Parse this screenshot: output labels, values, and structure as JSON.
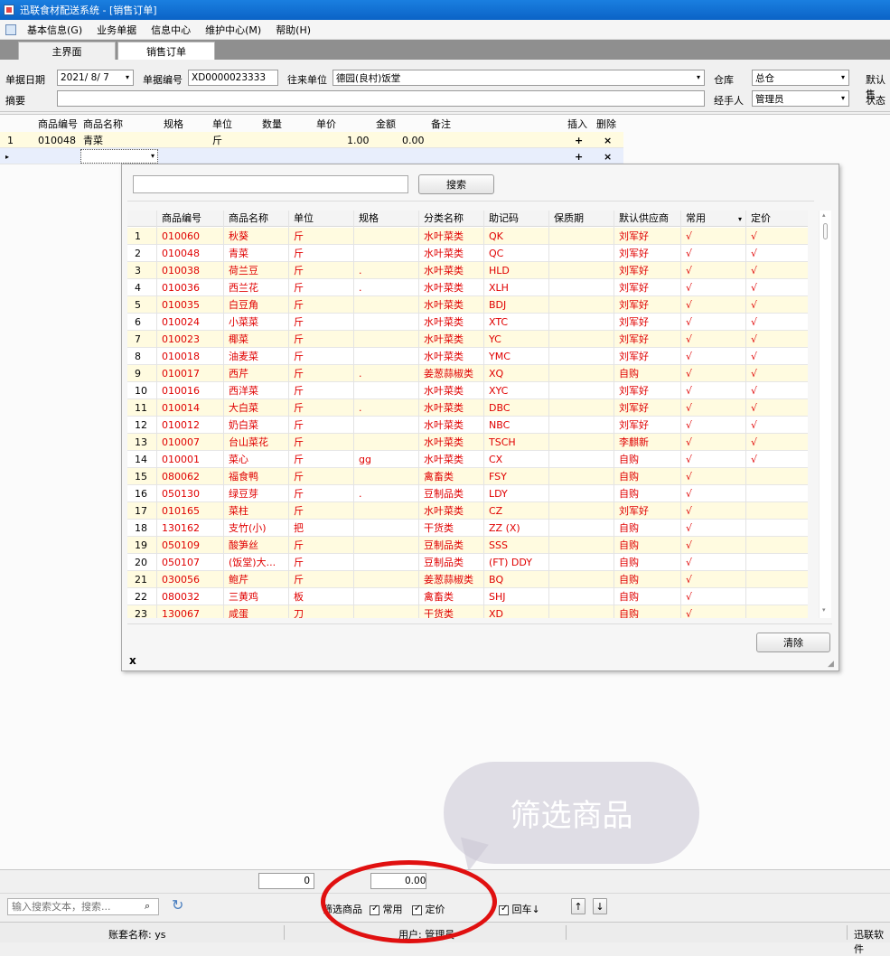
{
  "window": {
    "title": "迅联食材配送系统 - [销售订单]"
  },
  "menu": [
    "基本信息(G)",
    "业务单据",
    "信息中心",
    "维护中心(M)",
    "帮助(H)"
  ],
  "tabs": [
    {
      "label": "主界面"
    },
    {
      "label": "销售订单"
    }
  ],
  "header": {
    "date_label": "单据日期",
    "date_value": "2021/ 8/ 7",
    "doc_no_label": "单据编号",
    "doc_no_value": "XD0000023333",
    "partner_label": "往来单位",
    "partner_value": "德园(良村)饭堂",
    "warehouse_label": "仓库",
    "warehouse_value": "总仓",
    "default_label": "默认售",
    "summary_label": "摘要",
    "handler_label": "经手人",
    "handler_value": "管理员",
    "status_label": "状态"
  },
  "grid": {
    "headers": [
      "商品编号",
      "商品名称",
      "规格",
      "单位",
      "数量",
      "单价",
      "金额",
      "备注",
      "插入",
      "删除"
    ],
    "row1": {
      "no": "1",
      "code": "010048",
      "name": "青菜",
      "unit": "斤",
      "price": "1.00",
      "amount": "0.00",
      "insert": "+",
      "delete": "×"
    },
    "row2": {
      "insert": "+",
      "delete": "×"
    }
  },
  "popup": {
    "search_button": "搜索",
    "clear_button": "清除",
    "close": "x",
    "columns": [
      "商品编号",
      "商品名称",
      "单位",
      "规格",
      "分类名称",
      "助记码",
      "保质期",
      "默认供应商",
      "常用",
      "定价"
    ],
    "rows": [
      [
        "1",
        "010060",
        "秋葵",
        "斤",
        "",
        "水叶菜类",
        "QK",
        "",
        "刘军好",
        "√",
        "√"
      ],
      [
        "2",
        "010048",
        "青菜",
        "斤",
        "",
        "水叶菜类",
        "QC",
        "",
        "刘军好",
        "√",
        "√"
      ],
      [
        "3",
        "010038",
        "荷兰豆",
        "斤",
        ".",
        "水叶菜类",
        "HLD",
        "",
        "刘军好",
        "√",
        "√"
      ],
      [
        "4",
        "010036",
        "西兰花",
        "斤",
        ".",
        "水叶菜类",
        "XLH",
        "",
        "刘军好",
        "√",
        "√"
      ],
      [
        "5",
        "010035",
        "白豆角",
        "斤",
        "",
        "水叶菜类",
        "BDJ",
        "",
        "刘军好",
        "√",
        "√"
      ],
      [
        "6",
        "010024",
        "小菜菜",
        "斤",
        "",
        "水叶菜类",
        "XTC",
        "",
        "刘军好",
        "√",
        "√"
      ],
      [
        "7",
        "010023",
        "椰菜",
        "斤",
        "",
        "水叶菜类",
        "YC",
        "",
        "刘军好",
        "√",
        "√"
      ],
      [
        "8",
        "010018",
        "油麦菜",
        "斤",
        "",
        "水叶菜类",
        "YMC",
        "",
        "刘军好",
        "√",
        "√"
      ],
      [
        "9",
        "010017",
        "西芹",
        "斤",
        ".",
        "姜葱蒜椒类",
        "XQ",
        "",
        "自购",
        "√",
        "√"
      ],
      [
        "10",
        "010016",
        "西洋菜",
        "斤",
        "",
        "水叶菜类",
        "XYC",
        "",
        "刘军好",
        "√",
        "√"
      ],
      [
        "11",
        "010014",
        "大白菜",
        "斤",
        ".",
        "水叶菜类",
        "DBC",
        "",
        "刘军好",
        "√",
        "√"
      ],
      [
        "12",
        "010012",
        "奶白菜",
        "斤",
        "",
        "水叶菜类",
        "NBC",
        "",
        "刘军好",
        "√",
        "√"
      ],
      [
        "13",
        "010007",
        "台山菜花",
        "斤",
        "",
        "水叶菜类",
        "TSCH",
        "",
        "李麒新",
        "√",
        "√"
      ],
      [
        "14",
        "010001",
        "菜心",
        "斤",
        "gg",
        "水叶菜类",
        "CX",
        "",
        "自购",
        "√",
        "√"
      ],
      [
        "15",
        "080062",
        "福食鸭",
        "斤",
        "",
        "禽畜类",
        "FSY",
        "",
        "自购",
        "√",
        ""
      ],
      [
        "16",
        "050130",
        "绿豆芽",
        "斤",
        ".",
        "豆制品类",
        "LDY",
        "",
        "自购",
        "√",
        ""
      ],
      [
        "17",
        "010165",
        "菜柱",
        "斤",
        "",
        "水叶菜类",
        "CZ",
        "",
        "刘军好",
        "√",
        ""
      ],
      [
        "18",
        "130162",
        "支竹(小)",
        "把",
        "",
        "干货类",
        "ZZ (X)",
        "",
        "自购",
        "√",
        ""
      ],
      [
        "19",
        "050109",
        "酸笋丝",
        "斤",
        "",
        "豆制品类",
        "SSS",
        "",
        "自购",
        "√",
        ""
      ],
      [
        "20",
        "050107",
        "(饭堂)大...",
        "斤",
        "",
        "豆制品类",
        "(FT) DDY",
        "",
        "自购",
        "√",
        ""
      ],
      [
        "21",
        "030056",
        "鲍芹",
        "斤",
        "",
        "姜葱蒜椒类",
        "BQ",
        "",
        "自购",
        "√",
        ""
      ],
      [
        "22",
        "080032",
        "三黄鸡",
        "板",
        "",
        "禽畜类",
        "SHJ",
        "",
        "自购",
        "√",
        ""
      ],
      [
        "23",
        "130067",
        "咸蛋",
        "刀",
        "",
        "干货类",
        "XD",
        "",
        "自购",
        "√",
        ""
      ]
    ]
  },
  "totals": {
    "quantity": "0",
    "amount": "0.00"
  },
  "toolbar": {
    "search_placeholder": "输入搜索文本，搜索...",
    "filter_label": "筛选商品",
    "common_label": "常用",
    "pricing_label": "定价",
    "enter_label": "回车↓",
    "up": "↑",
    "down": "↓"
  },
  "status": {
    "account": "账套名称: ys",
    "user": "用户: 管理员",
    "brand": "迅联软件"
  },
  "overlay": {
    "bubble_text": "筛选商品"
  },
  "colors": {
    "accent_red": "#e00000",
    "title_blue": "#0b63c6",
    "row_highlight": "#fffbe0"
  }
}
